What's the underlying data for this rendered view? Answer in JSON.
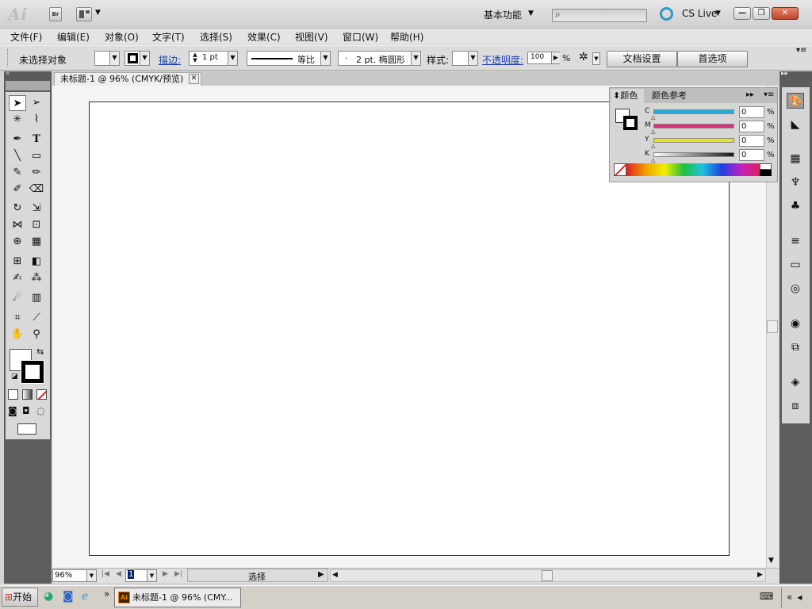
{
  "window": {
    "logo": "Ai",
    "bridge_button": "Br",
    "workspace": "基本功能",
    "cs_live": "CS Live",
    "min": "—",
    "max": "❐",
    "close": "✕"
  },
  "menu": [
    {
      "label": "文件(F)"
    },
    {
      "label": "编辑(E)"
    },
    {
      "label": "对象(O)"
    },
    {
      "label": "文字(T)"
    },
    {
      "label": "选择(S)"
    },
    {
      "label": "效果(C)"
    },
    {
      "label": "视图(V)"
    },
    {
      "label": "窗口(W)"
    },
    {
      "label": "帮助(H)"
    }
  ],
  "control_bar": {
    "selection_status": "未选择对象",
    "stroke_label": "描边:",
    "stroke_weight": "1 pt",
    "stroke_profile": "等比",
    "brush": "2 pt. 椭圆形",
    "brush_dot": "·",
    "style_label": "样式:",
    "opacity_label": "不透明度:",
    "opacity_value": "100",
    "opacity_unit": "%",
    "doc_setup": "文档设置",
    "preferences": "首选项"
  },
  "document": {
    "tab_title": "未标题-1 @ 96% (CMYK/预览)",
    "tab_close": "✕"
  },
  "color_panel": {
    "tab_color": "颜色",
    "tab_guide": "颜色参考",
    "sliders": [
      {
        "channel": "C",
        "value": "0",
        "unit": "%",
        "color": "#2aa8d8"
      },
      {
        "channel": "M",
        "value": "0",
        "unit": "%",
        "color": "#d8307a"
      },
      {
        "channel": "Y",
        "value": "0",
        "unit": "%",
        "color": "#f0e020"
      },
      {
        "channel": "K",
        "value": "0",
        "unit": "%",
        "color": "#1a1a1a"
      }
    ]
  },
  "status_bar": {
    "zoom": "96%",
    "artboard_number": "1",
    "status_text": "选择"
  },
  "taskbar": {
    "start": "开始",
    "task_item": "未标题-1 @ 96% (CMY...",
    "chevron": "»",
    "tray_chevron": "«"
  },
  "colors": {
    "link": "#1a3fb5",
    "close_button": "#c0442b",
    "cs_live_ring": "#3596c9"
  }
}
